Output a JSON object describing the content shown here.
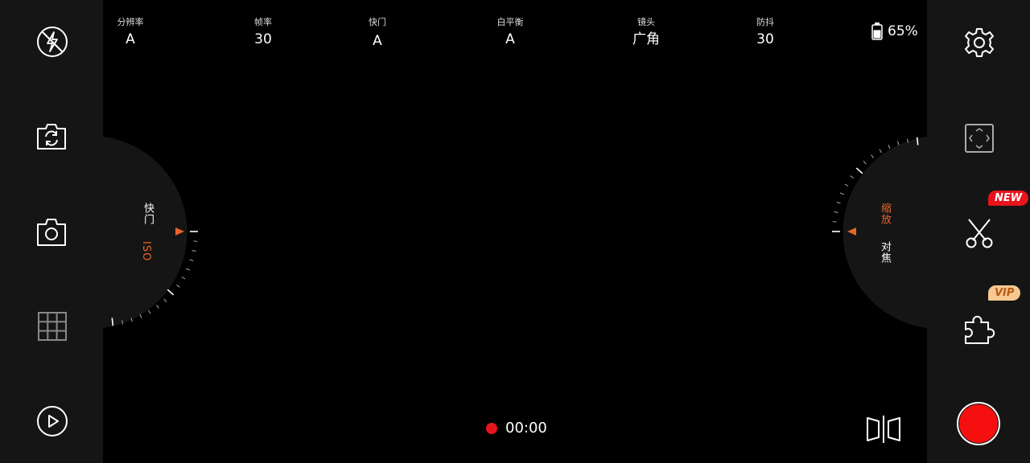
{
  "params": [
    {
      "label": "分辨率",
      "value": "A"
    },
    {
      "label": "帧率",
      "value": "30"
    },
    {
      "label": "快门",
      "value": "A"
    },
    {
      "label": "白平衡",
      "value": "A"
    },
    {
      "label": "镜头",
      "value": "广角"
    },
    {
      "label": "防抖",
      "value": "30"
    }
  ],
  "battery": {
    "percent": "65%",
    "level": 0.65
  },
  "left_dial": {
    "label_primary": "快门",
    "label_active": "ISO"
  },
  "right_dial": {
    "label_active": "缩放",
    "label_primary": "对焦"
  },
  "recording": {
    "time": "00:00"
  },
  "badges": {
    "new": "NEW",
    "vip": "VIP"
  },
  "colors": {
    "accent": "#e8652a",
    "record": "#f50f0f",
    "panel": "#151515"
  },
  "icons": {
    "left": [
      "flash-off-icon",
      "flip-camera-icon",
      "camera-icon",
      "grid-icon",
      "play-icon"
    ],
    "right": [
      "settings-icon",
      "frame-icon",
      "scissors-icon",
      "puzzle-icon",
      "compare-icon"
    ]
  }
}
